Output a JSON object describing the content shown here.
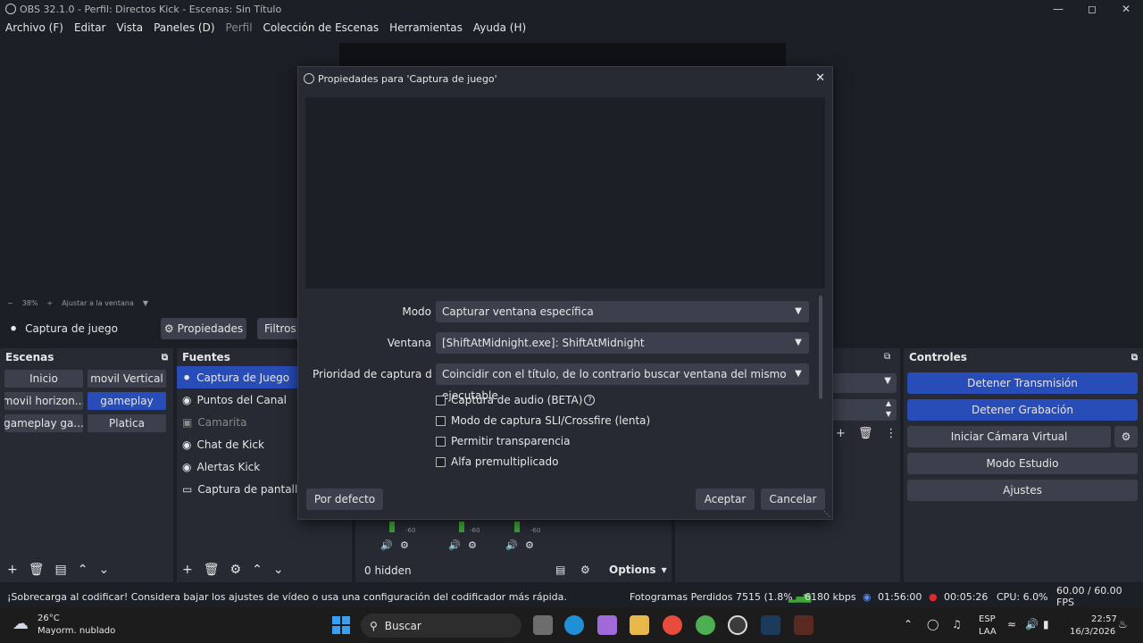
{
  "window": {
    "title": "OBS 32.1.0 - Perfil: Directos Kick - Escenas: Sin Título"
  },
  "menu": [
    "Archivo (F)",
    "Editar",
    "Vista",
    "Paneles (D)",
    "Perfil",
    "Colección de Escenas",
    "Herramientas",
    "Ayuda (H)"
  ],
  "zoom": {
    "value": "38%",
    "fit_label": "Ajustar a la ventana"
  },
  "sourcebar": {
    "current_source": "Captura de juego",
    "properties": "Propiedades",
    "filters": "Filtros"
  },
  "scenes": {
    "title": "Escenas",
    "items": [
      "Inicio",
      "movil Vertical",
      "movil horizon...",
      "gameplay",
      "gameplay ga...",
      "Platica"
    ],
    "selected": "gameplay"
  },
  "sources": {
    "title": "Fuentes",
    "items": [
      "Captura de Juego",
      "Puntos del Canal",
      "Camarita",
      "Chat de Kick",
      "Alertas Kick",
      "Captura de pantalla"
    ]
  },
  "mixer": {
    "hidden_label": "0 hidden",
    "options_label": "Options",
    "meter_label": "-60"
  },
  "controls": {
    "title": "Controles",
    "stop_stream": "Detener Transmisión",
    "stop_record": "Detener Grabación",
    "virtual_cam": "Iniciar Cámara Virtual",
    "studio_mode": "Modo Estudio",
    "settings": "Ajustes"
  },
  "dialog": {
    "title": "Propiedades para 'Captura de juego'",
    "mode_label": "Modo",
    "mode_value": "Capturar ventana específica",
    "window_label": "Ventana",
    "window_value": "[ShiftAtMidnight.exe]: ShiftAtMidnight",
    "priority_label": "Prioridad de captura de ve",
    "priority_value": "Coincidir con el título, de lo contrario buscar ventana del mismo ejecutable",
    "checks": [
      "Captura de audio (BETA)",
      "Modo de captura SLI/Crossfire (lenta)",
      "Permitir transparencia",
      "Alfa premultiplicado"
    ],
    "defaults": "Por defecto",
    "accept": "Aceptar",
    "cancel": "Cancelar"
  },
  "status": {
    "warning": "¡Sobrecarga al codificar! Considera bajar los ajustes de vídeo o usa una configuración del codificador más rápida.",
    "dropped": "Fotogramas Perdidos 7515 (1.8%",
    "bitrate": "6180 kbps",
    "stream_time": "01:56:00",
    "rec_time": "00:05:26",
    "cpu": "CPU: 6.0%",
    "fps": "60.00 / 60.00 FPS"
  },
  "taskbar": {
    "weather_temp": "26°C",
    "weather_desc": "Mayorm. nublado",
    "search": "Buscar",
    "lang1": "ESP",
    "lang2": "LAA",
    "time": "22:57",
    "date": "16/3/2026"
  },
  "colors": {
    "accent": "#284cb8",
    "panel": "#272a33",
    "button": "#3c404d",
    "background": "#1d1f26"
  }
}
